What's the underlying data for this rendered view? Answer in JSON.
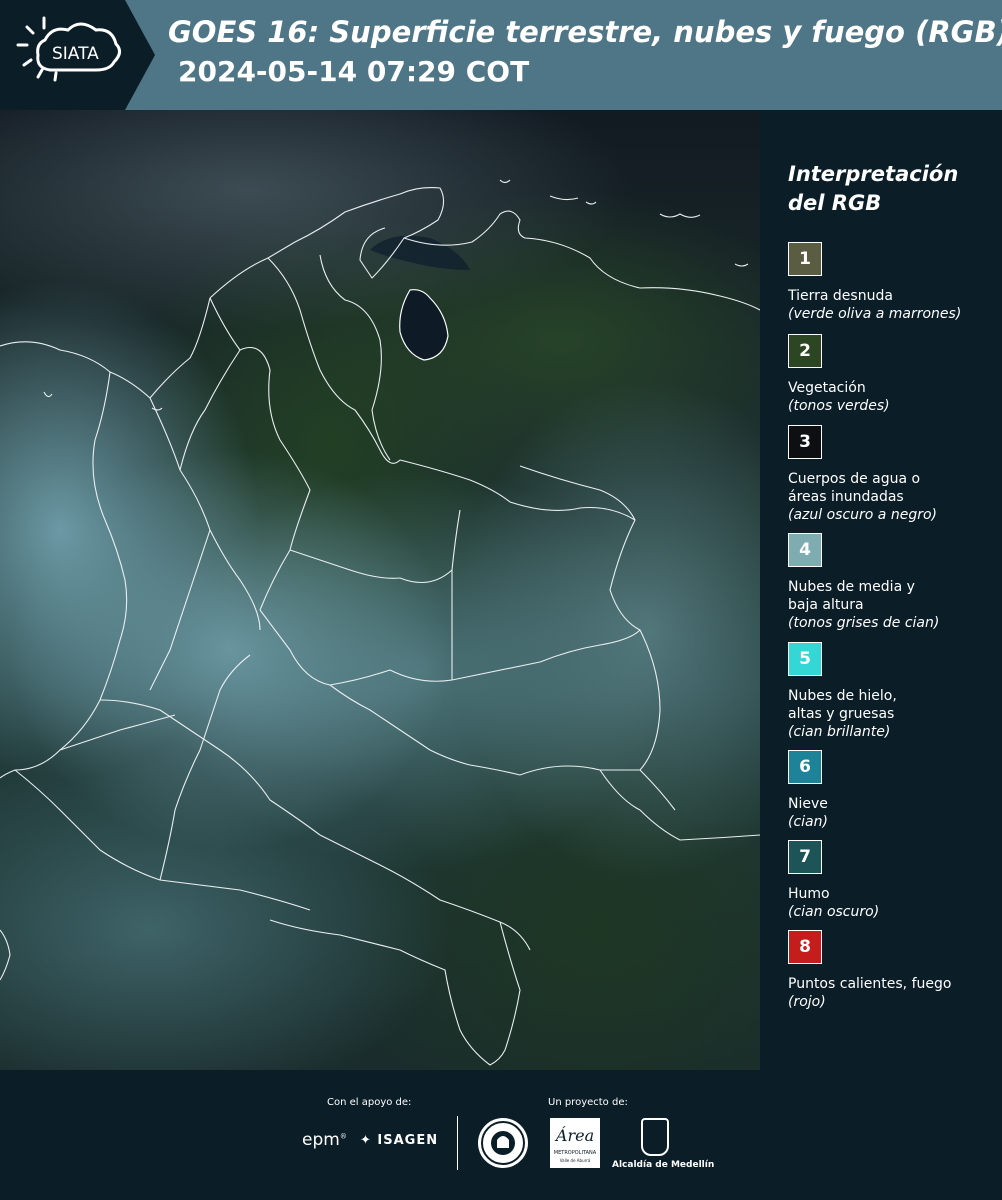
{
  "header": {
    "logo_text": "SIATA",
    "title": "GOES 16: Superficie terrestre, nubes y fuego (RGB)",
    "subtitle": "2024-05-14 07:29 COT",
    "colors": {
      "banner": "#4f7686",
      "logo_bg": "#0b1d27"
    }
  },
  "legend": {
    "title": "Interpretación del RGB",
    "items": [
      {
        "num": "1",
        "color": "#5b5d43",
        "label": "Tierra desnuda",
        "note": "(verde oliva a marrones)"
      },
      {
        "num": "2",
        "color": "#2c4522",
        "label": "Vegetación",
        "note": "(tonos verdes)"
      },
      {
        "num": "3",
        "color": "#0d0f12",
        "label": "Cuerpos de agua o áreas inundadas",
        "note": "(azul oscuro a negro)"
      },
      {
        "num": "4",
        "color": "#7eacb0",
        "label": "Nubes de media y baja altura",
        "note": "(tonos grises de cian)"
      },
      {
        "num": "5",
        "color": "#32d7d6",
        "label": "Nubes de hielo, altas y gruesas",
        "note": "(cian brillante)"
      },
      {
        "num": "6",
        "color": "#1c8399",
        "label": "Nieve",
        "note": "(cian)"
      },
      {
        "num": "7",
        "color": "#1d5458",
        "label": "Humo",
        "note": "(cian oscuro)"
      },
      {
        "num": "8",
        "color": "#c41d1c",
        "label": "Puntos calientes, fuego",
        "note": "(rojo)"
      }
    ]
  },
  "footer": {
    "support_label": "Con el apoyo de:",
    "project_label": "Un proyecto de:",
    "sponsors": [
      "epm",
      "ISAGEN"
    ],
    "area_logo_word": "Área",
    "area_logo_sub": "METROPOLITANA",
    "area_logo_sub2": "Valle de Aburrá",
    "medellin": "Alcaldía de Medellín"
  }
}
